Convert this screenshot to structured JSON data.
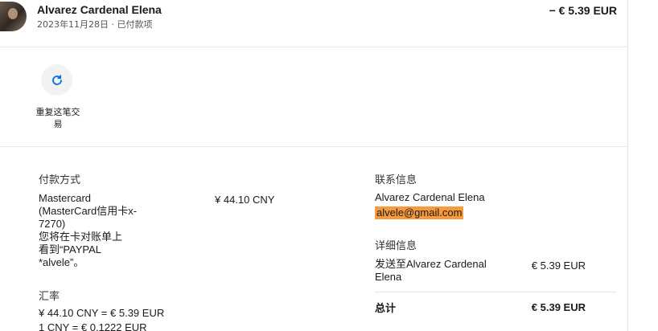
{
  "header": {
    "name": "Alvarez Cardenal Elena",
    "date_status": "2023年11月28日 · 已付款项",
    "amount": "− € 5.39 EUR"
  },
  "actions": {
    "repeat_label": "重复这笔交易"
  },
  "payment": {
    "title": "付款方式",
    "description_lines": [
      "Mastercard",
      "(MasterCard信用卡x-",
      "7270)",
      "您将在卡对账单上",
      "看到“PAYPAL",
      "*alvele”。"
    ],
    "amount": "¥ 44.10 CNY"
  },
  "exchange": {
    "title": "汇率",
    "line1": "¥ 44.10 CNY = € 5.39 EUR",
    "line2": "1 CNY = € 0.1222 EUR"
  },
  "contact": {
    "title": "联系信息",
    "name": "Alvarez Cardenal Elena",
    "email": "alvele@gmail.com"
  },
  "details": {
    "title": "详细信息",
    "sent_to": "发送至Alvarez Cardenal Elena",
    "sent_amount": "€ 5.39 EUR",
    "total_label": "总计",
    "total_amount": "€ 5.39 EUR"
  },
  "colors": {
    "email_highlight": "#f79a3e",
    "icon_blue": "#0070e0"
  },
  "icons": {
    "repeat": "refresh-icon"
  }
}
